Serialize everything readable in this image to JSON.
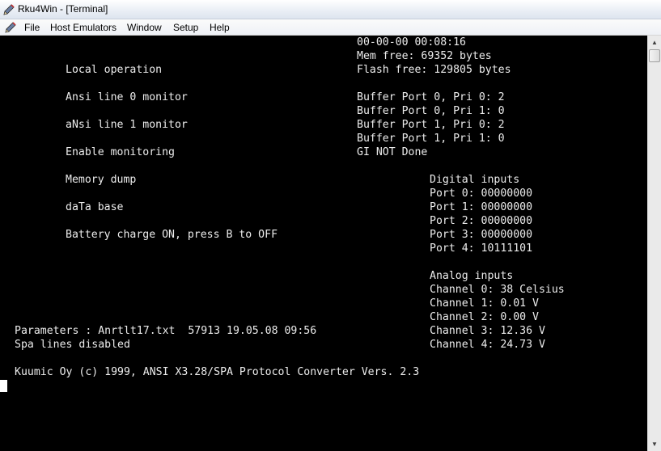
{
  "window": {
    "title": "Rku4Win - [Terminal]"
  },
  "menu": {
    "items": [
      "File",
      "Host Emulators",
      "Window",
      "Setup",
      "Help"
    ]
  },
  "terminal": {
    "menu_options": [
      "Local operation",
      "Ansi line 0 monitor",
      "aNsi line 1 monitor",
      "Enable monitoring",
      "Memory dump",
      "daTa base",
      "Battery charge ON, press B to OFF"
    ],
    "status": {
      "datetime": "00-00-00 00:08:16",
      "mem_free": "Mem free: 69352 bytes",
      "flash_free": "Flash free: 129805 bytes",
      "buffer_lines": [
        "Buffer Port 0, Pri 0: 2",
        "Buffer Port 0, Pri 1: 0",
        "Buffer Port 1, Pri 0: 2",
        "Buffer Port 1, Pri 1: 0"
      ],
      "gi_status": "GI NOT Done"
    },
    "digital_inputs": {
      "title": "Digital inputs",
      "ports": [
        "Port 0: 00000000",
        "Port 1: 00000000",
        "Port 2: 00000000",
        "Port 3: 00000000",
        "Port 4: 10111101"
      ]
    },
    "analog_inputs": {
      "title": "Analog inputs",
      "channels": [
        "Channel 0: 38 Celsius",
        "Channel 1: 0.01 V",
        "Channel 2: 0.00 V",
        "Channel 3: 12.36 V",
        "Channel 4: 24.73 V"
      ]
    },
    "parameters": "Parameters : Anrtlt17.txt  57913 19.05.08 09:56",
    "spa_lines": "Spa lines disabled",
    "copyright": "Kuumic Oy (c) 1999, ANSI X3.28/SPA Protocol Converter Vers. 2.3"
  },
  "colors": {
    "terminal_bg": "#000000",
    "terminal_fg": "#ececec"
  }
}
